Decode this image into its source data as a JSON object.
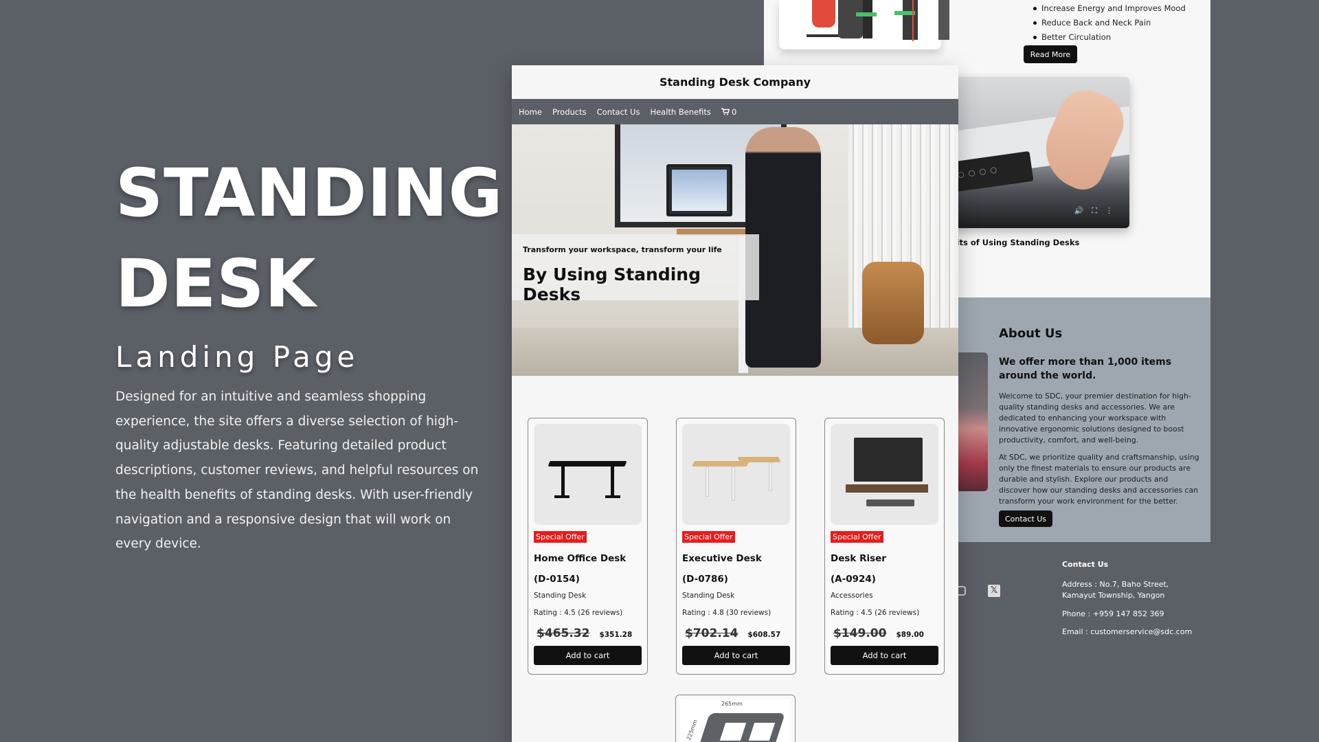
{
  "hero": {
    "line1": "STANDING",
    "line2": "DESK",
    "subtitle": "Landing Page",
    "description": "Designed for an intuitive and seamless shopping experience, the site offers a diverse selection of high-quality adjustable desks. Featuring detailed product descriptions, customer reviews, and helpful resources on the health benefits of standing desks. With user-friendly navigation and a responsive design that will work on every device."
  },
  "front": {
    "brand": "Standing Desk Company",
    "nav": [
      "Home",
      "Products",
      "Contact Us",
      "Health Benefits"
    ],
    "cart_count": "0",
    "hero_small": "Transform your workspace, transform your life",
    "hero_big": "By Using Standing Desks",
    "products": [
      {
        "badge": "Special Offer",
        "name": "Home Office Desk",
        "code": "(D-0154)",
        "category": "Standing Desk",
        "rating": "Rating : 4.5 (26 reviews)",
        "old_price": "$465.32",
        "new_price": "$351.28",
        "button": "Add to cart"
      },
      {
        "badge": "Special Offer",
        "name": "Executive Desk",
        "code": "(D-0786)",
        "category": "Standing Desk",
        "rating": "Rating : 4.8 (30 reviews)",
        "old_price": "$702.14",
        "new_price": "$608.57",
        "button": "Add to cart"
      },
      {
        "badge": "Special Offer",
        "name": "Desk Riser",
        "code": "(A-0924)",
        "category": "Accessories",
        "rating": "Rating : 4.5 (26 reviews)",
        "old_price": "$149.00",
        "new_price": "$89.00",
        "button": "Add to cart"
      }
    ],
    "card4_dimension": "265mm",
    "card4_side_dimension": "225mm"
  },
  "back": {
    "benefits": [
      "Increase Energy and Improves Mood",
      "Reduce Back and Neck Pain",
      "Better Circulation"
    ],
    "read_more": "Read More",
    "video_caption": "fits of Using Standing Desks",
    "about_title": "About Us",
    "about_tagline": "We offer more than 1,000 items around the world.",
    "about_p1": "Welcome to SDC, your premier destination for high-quality standing desks and accessories. We are dedicated to enhancing your workspace with innovative ergonomic solutions designed to boost productivity, comfort, and well-being.",
    "about_p2": "At SDC, we prioritize quality and craftsmanship, using only the finest materials to ensure our products are durable and stylish. Explore our products and discover how our standing desks and accessories can transform your work environment for the better.",
    "contact_button": "Contact Us",
    "footer": {
      "contact_title": "Contact Us",
      "address": "Address : No.7, Baho Street, Kamayut Township, Yangon",
      "phone": "Phone : +959 147 852 369",
      "email": "Email : customerservice@sdc.com"
    }
  }
}
